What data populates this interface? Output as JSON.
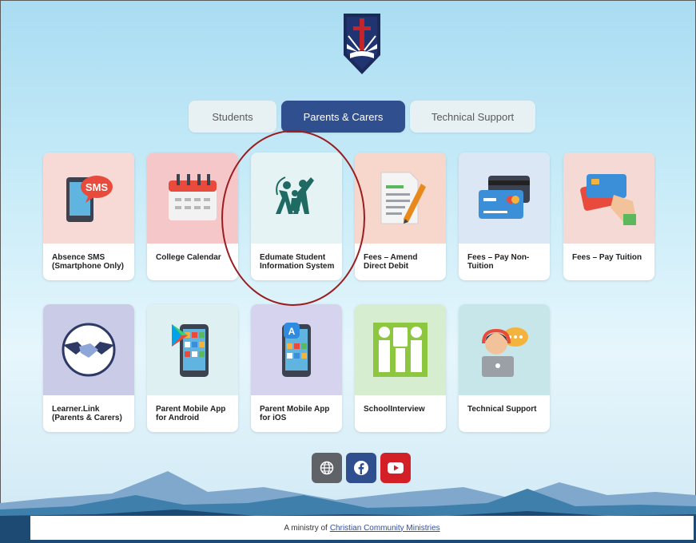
{
  "tabs": [
    {
      "label": "Students",
      "active": false
    },
    {
      "label": "Parents & Carers",
      "active": true
    },
    {
      "label": "Technical Support",
      "active": false
    }
  ],
  "tiles_row1": [
    {
      "label": "Absence SMS (Smartphone Only)",
      "icon": "sms-phone-icon",
      "bg": "#f7d9d6"
    },
    {
      "label": "College Calendar",
      "icon": "calendar-icon",
      "bg": "#f6c7c8"
    },
    {
      "label": "Edumate Student Information System",
      "icon": "edumate-logo-icon",
      "bg": "#e6f3f4"
    },
    {
      "label": "Fees – Amend Direct Debit",
      "icon": "document-pen-icon",
      "bg": "#f7d6cc"
    },
    {
      "label": "Fees – Pay Non-Tuition",
      "icon": "credit-cards-icon",
      "bg": "#dbe7f4"
    },
    {
      "label": "Fees – Pay Tuition",
      "icon": "hand-card-icon",
      "bg": "#f5d9d5"
    }
  ],
  "tiles_row2": [
    {
      "label": "Learner.Link (Parents & Carers)",
      "icon": "handshake-icon",
      "bg": "#c9cbe7"
    },
    {
      "label": "Parent Mobile App for Android",
      "icon": "android-phone-icon",
      "bg": "#dff0f2"
    },
    {
      "label": "Parent Mobile App for iOS",
      "icon": "ios-phone-icon",
      "bg": "#d6d3ef"
    },
    {
      "label": "SchoolInterview",
      "icon": "schoolinterview-logo-icon",
      "bg": "#d6edcf"
    },
    {
      "label": "Technical Support",
      "icon": "support-agent-icon",
      "bg": "#c6e6ea"
    }
  ],
  "social": [
    {
      "name": "website",
      "icon": "globe-icon",
      "color": "#5f6368"
    },
    {
      "name": "facebook",
      "icon": "facebook-icon",
      "color": "#2f4f8f"
    },
    {
      "name": "youtube",
      "icon": "youtube-icon",
      "color": "#d32027"
    }
  ],
  "footer": {
    "prefix": "A ministry of",
    "link": "Christian Community Ministries"
  },
  "colors": {
    "accent": "#2f4f8f",
    "highlight_circle": "#9b1d20"
  }
}
